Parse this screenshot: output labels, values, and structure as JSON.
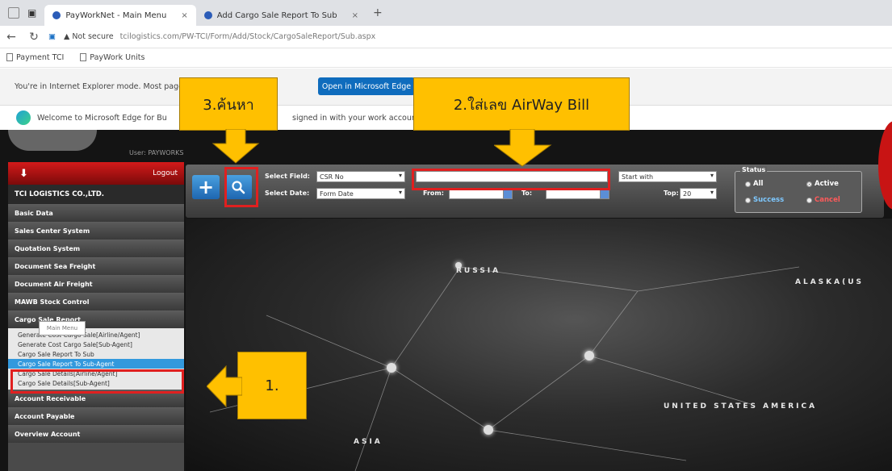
{
  "browser": {
    "tabs": [
      {
        "label": "PayWorkNet - Main Menu",
        "active": true
      },
      {
        "label": "Add Cargo Sale Report To Sub",
        "active": false
      }
    ],
    "address_warning": "Not secure",
    "url": "tcilogistics.com/PW-TCI/Form/Add/Stock/CargoSaleReport/Sub.aspx",
    "favorites": [
      "Payment TCI",
      "PayWork Units"
    ],
    "ie_mode_text": "You're in Internet Explorer mode. Most pages",
    "ie_button": "Open in Microsoft Edge",
    "welcome_text": "Welcome to Microsoft Edge for Bu",
    "welcome_text2": "signed in with your work account"
  },
  "page": {
    "user_label": "User: PAYWORKS",
    "sidebar": {
      "logout": "Logout",
      "company": "TCI LOGISTICS CO.,LTD.",
      "menu_top": [
        "Basic Data",
        "Sales Center System",
        "Quotation System",
        "Document Sea Freight",
        "Document Air Freight",
        "MAWB Stock Control",
        "Cargo Sale Report"
      ],
      "submenu": [
        "Generate Cost Cargo Sale[Airline/Agent]",
        "Generate Cost Cargo Sale[Sub-Agent]",
        "Cargo Sale Report To Sub",
        "Cargo Sale Report To Sub-Agent",
        "Cargo Sale Details[Airline/Agent]",
        "Cargo Sale Details[Sub-Agent]"
      ],
      "menu_bottom": [
        "Account Receivable",
        "Account Payable",
        "Overview Account"
      ],
      "tooltip": "Main Menu"
    },
    "toolbar": {
      "select_field_label": "Select Field:",
      "select_field_value": "CSR No",
      "select_date_label": "Select Date:",
      "select_date_value": "Form Date",
      "from_label": "From:",
      "to_label": "To:",
      "match_value": "Start with",
      "top_label": "Top:",
      "top_value": "20",
      "search_value": ""
    },
    "status": {
      "title": "Status",
      "all": "All",
      "active": "Active",
      "success": "Success",
      "cancel": "Cancel"
    },
    "map_labels": {
      "russia": "RUSSIA",
      "alaska": "ALASKA(US",
      "usa": "UNITED STATES AMERICA",
      "asia": "ASIA"
    }
  },
  "annotations": {
    "step1": "1.",
    "step2": "2.ใส่เลข AirWay Bill",
    "step3": "3.ค้นหา"
  },
  "colors": {
    "highlight": "#e02020",
    "callout": "#ffc000",
    "sidebar_header": "#d41a1a",
    "selected_item": "#3399dd"
  }
}
